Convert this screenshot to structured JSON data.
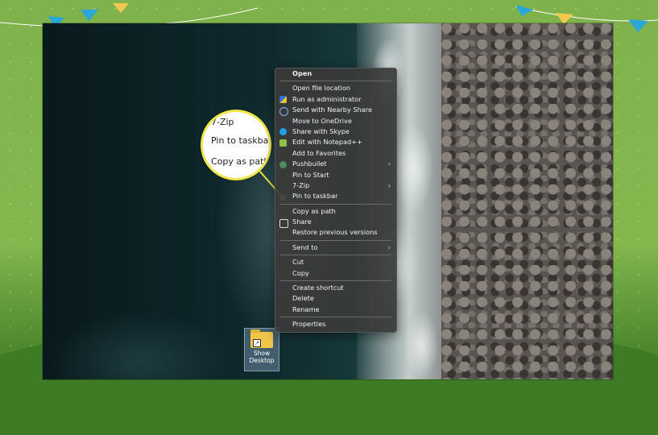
{
  "context_menu": {
    "items": [
      {
        "label": "Open",
        "bold": true,
        "icon": ""
      },
      {
        "sep": true
      },
      {
        "label": "Open file location",
        "icon": ""
      },
      {
        "label": "Run as administrator",
        "icon": "shield-icon"
      },
      {
        "label": "Send with Nearby Share",
        "icon": "nearby-share-icon"
      },
      {
        "label": "Move to OneDrive",
        "icon": ""
      },
      {
        "label": "Share with Skype",
        "icon": "skype-icon"
      },
      {
        "label": "Edit with Notepad++",
        "icon": "notepad-plus-plus-icon"
      },
      {
        "label": "Add to Favorites",
        "icon": ""
      },
      {
        "label": "Pushbullet",
        "icon": "pushbullet-icon",
        "submenu": true
      },
      {
        "label": "Pin to Start",
        "icon": ""
      },
      {
        "label": "7-Zip",
        "icon": "",
        "submenu": true
      },
      {
        "label": "Pin to taskbar",
        "icon": ""
      },
      {
        "sep": true
      },
      {
        "label": "Copy as path",
        "icon": ""
      },
      {
        "label": "Share",
        "icon": "share-icon"
      },
      {
        "label": "Restore previous versions",
        "icon": ""
      },
      {
        "sep": true
      },
      {
        "label": "Send to",
        "icon": "",
        "submenu": true
      },
      {
        "sep": true
      },
      {
        "label": "Cut",
        "icon": ""
      },
      {
        "label": "Copy",
        "icon": ""
      },
      {
        "sep": true
      },
      {
        "label": "Create shortcut",
        "icon": ""
      },
      {
        "label": "Delete",
        "icon": ""
      },
      {
        "label": "Rename",
        "icon": ""
      },
      {
        "sep": true
      },
      {
        "label": "Properties",
        "icon": ""
      }
    ]
  },
  "callout": {
    "lines": [
      "7-Zip",
      "Pin to taskbar",
      "Copy as path"
    ],
    "highlight_color": "#f0e64a"
  },
  "desktop_icon": {
    "label": "Show Desktop",
    "icon": "folder-shortcut-icon"
  },
  "colors": {
    "menu_bg": "#3a3a3a",
    "menu_text": "#f2f2f2",
    "frame_green": "#84b84f"
  }
}
